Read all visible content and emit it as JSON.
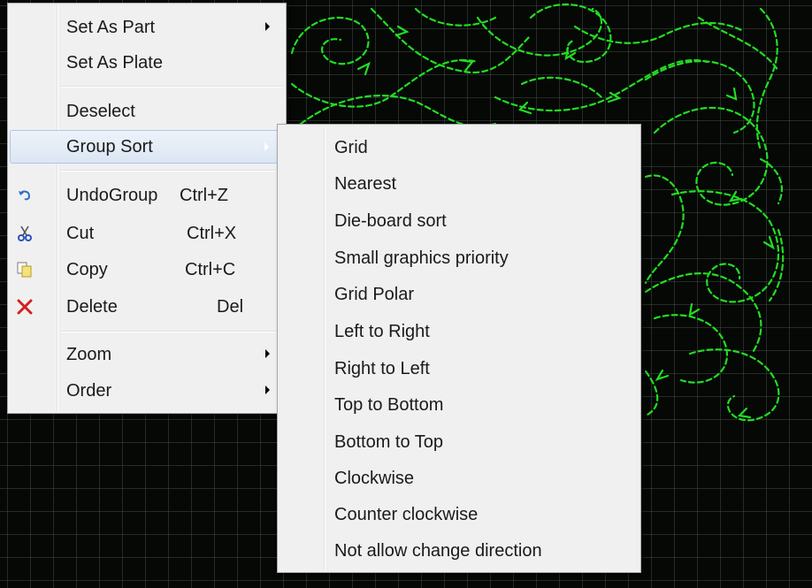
{
  "context_menu": {
    "items": [
      {
        "label": "Set As Part",
        "submenu": true
      },
      {
        "label": "Set As Plate"
      },
      {
        "label": "Deselect"
      },
      {
        "label": "Group Sort",
        "submenu": true,
        "highlighted": true
      },
      {
        "label": "UndoGroup",
        "shortcut": "Ctrl+Z",
        "icon": "undo-icon"
      },
      {
        "label": "Cut",
        "shortcut": "Ctrl+X",
        "icon": "scissors-icon"
      },
      {
        "label": "Copy",
        "shortcut": "Ctrl+C",
        "icon": "copy-icon"
      },
      {
        "label": "Delete",
        "shortcut": "Del",
        "icon": "delete-x-icon"
      },
      {
        "label": "Zoom",
        "submenu": true
      },
      {
        "label": "Order",
        "submenu": true
      }
    ]
  },
  "group_sort_submenu": {
    "items": [
      "Grid",
      "Nearest",
      "Die-board sort",
      "Small graphics priority",
      "Grid Polar",
      "Left to Right",
      "Right to Left",
      "Top to Bottom",
      "Bottom to Top",
      "Clockwise",
      "Counter clockwise",
      "Not allow change direction"
    ]
  },
  "colors": {
    "canvas_background": "#050805",
    "path_stroke": "#22dd22",
    "menu_background": "#f0f0f0",
    "highlight": "#dbe6f4",
    "delete_icon": "#d42020"
  }
}
